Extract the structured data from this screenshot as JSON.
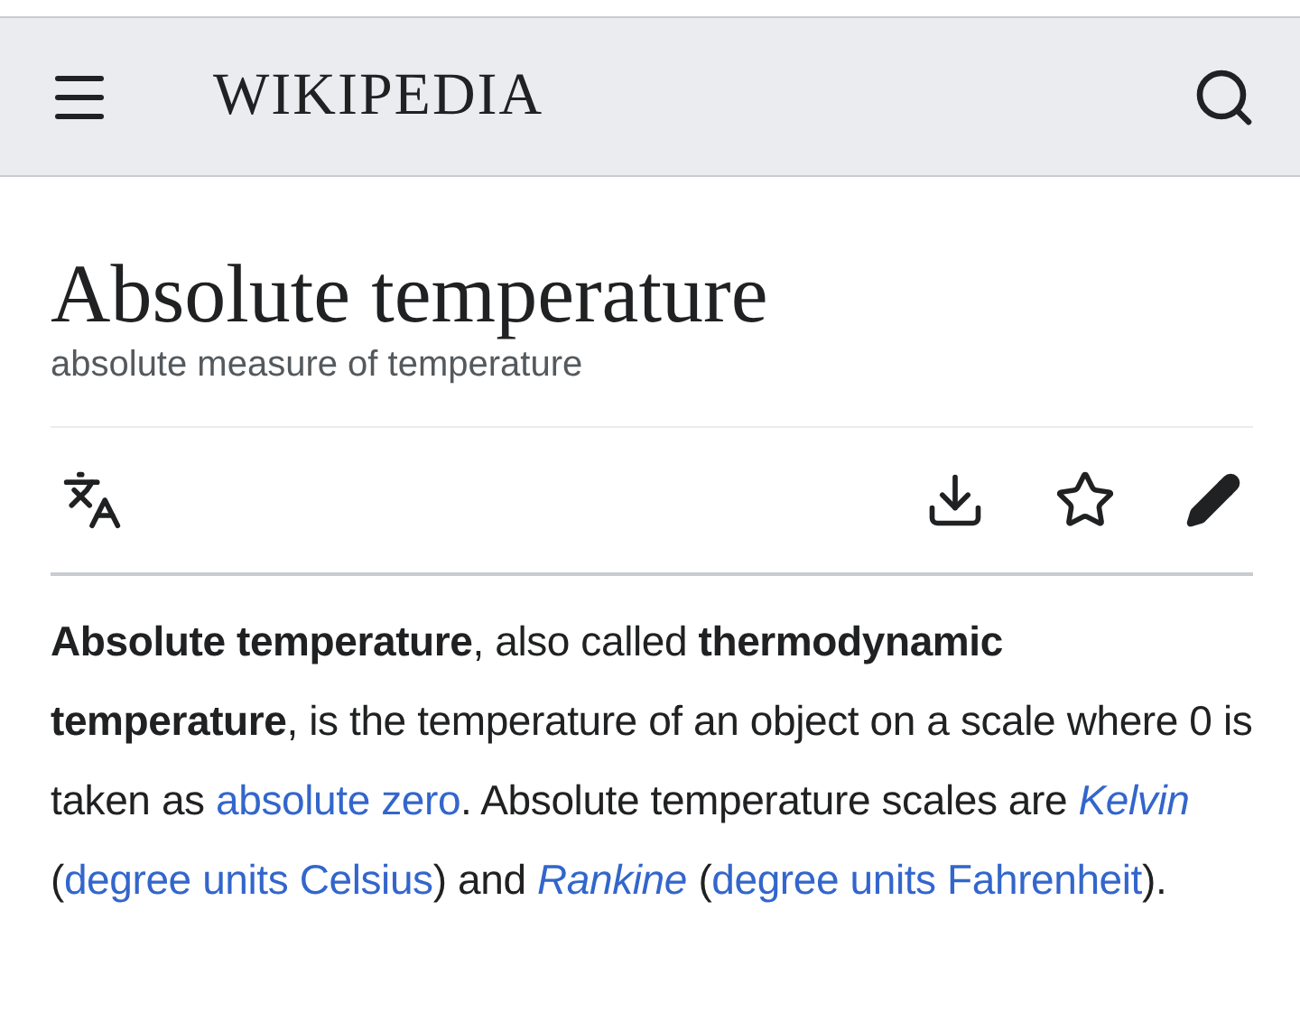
{
  "header": {
    "logo": "WIKIPEDIA"
  },
  "article": {
    "title": "Absolute temperature",
    "description": "absolute measure of temperature",
    "paragraph": [
      {
        "kind": "text",
        "text": "**Absolute temperature**, also called **thermodynamic temperature**, is the temperature of an object on a scale where 0 is taken as "
      },
      {
        "kind": "link",
        "text": "absolute zero",
        "italic": false
      },
      {
        "kind": "text",
        "text": ". Absolute temperature scales are "
      },
      {
        "kind": "link",
        "text": "Kelvin",
        "italic": true
      },
      {
        "kind": "text",
        "text": " ("
      },
      {
        "kind": "link",
        "text": "degree units Celsius",
        "italic": false
      },
      {
        "kind": "text",
        "text": ") and "
      },
      {
        "kind": "link",
        "text": "Rankine",
        "italic": true
      },
      {
        "kind": "text",
        "text": " ("
      },
      {
        "kind": "link",
        "text": "degree units Fahrenheit",
        "italic": false
      },
      {
        "kind": "text",
        "text": ")."
      }
    ]
  }
}
